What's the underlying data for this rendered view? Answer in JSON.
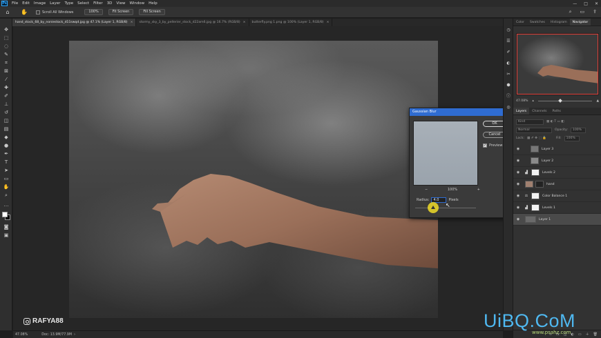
{
  "menu": [
    "File",
    "Edit",
    "Image",
    "Layer",
    "Type",
    "Select",
    "Filter",
    "3D",
    "View",
    "Window",
    "Help"
  ],
  "window_controls": [
    "—",
    "□",
    "✕"
  ],
  "options": {
    "scroll_all_label": "Scroll All Windows",
    "zoom": "100%",
    "fit_screen": "Fit Screen",
    "fill_screen": "Fill Screen"
  },
  "tabs": [
    {
      "label": "hand_stock_68_by_noniestock_d11swqd.jpg @ 47.1% (Layer 1, RGB/8)",
      "active": true
    },
    {
      "label": "stormy_sky_3_by_pellerier_stock_d22am6.jpg @ 16.7% (RGB/8)",
      "active": false
    },
    {
      "label": "butterfly.png 1.png @ 100% (Layer 1, RGB/8)",
      "active": false
    }
  ],
  "status": {
    "zoom": "47.08%",
    "doc": "Doc: 13.9M/77.9M"
  },
  "watermark": "RAFYA88",
  "dialog": {
    "title": "Gaussian Blur",
    "ok": "OK",
    "cancel": "Cancel",
    "preview_label": "Preview",
    "preview_checked": true,
    "zoom": "100%",
    "zoom_out": "−",
    "zoom_in": "+",
    "radius_label": "Radius:",
    "radius_value": "4.0",
    "radius_unit": "Pixels"
  },
  "panels": {
    "top_tabs": [
      "Color",
      "Swatches",
      "Histogram",
      "Navigator"
    ],
    "navigator_zoom": "47.08%",
    "layer_tabs": [
      "Layers",
      "Channels",
      "Paths"
    ],
    "kind": "Kind",
    "blend_mode": "Normal",
    "opacity_label": "Opacity:",
    "opacity": "100%",
    "lock_label": "Lock:",
    "fill_label": "Fill:",
    "fill": "100%"
  },
  "layers": [
    {
      "name": "Layer 3",
      "type": "pixel",
      "mask": false,
      "adjust": false,
      "selected": false
    },
    {
      "name": "Layer 2",
      "type": "pixel",
      "mask": false,
      "adjust": false,
      "selected": false
    },
    {
      "name": "Levels 2",
      "type": "adjustment",
      "mask": true,
      "adjust": true,
      "selected": false
    },
    {
      "name": "hand",
      "type": "pixel",
      "mask": true,
      "adjust": false,
      "selected": false
    },
    {
      "name": "Color Balance 1",
      "type": "adjustment",
      "mask": true,
      "adjust": true,
      "selected": false
    },
    {
      "name": "Levels 1",
      "type": "adjustment",
      "mask": true,
      "adjust": true,
      "selected": false
    },
    {
      "name": "Layer 1",
      "type": "pixel",
      "mask": false,
      "adjust": false,
      "selected": true
    }
  ],
  "footer_icons": [
    "link-icon",
    "fx-icon",
    "mask-icon",
    "adjust-icon",
    "folder-icon",
    "new-layer-icon",
    "trash-icon"
  ],
  "site_watermark": "UiBQ.CoM",
  "site_sub": "www.psahz.com"
}
